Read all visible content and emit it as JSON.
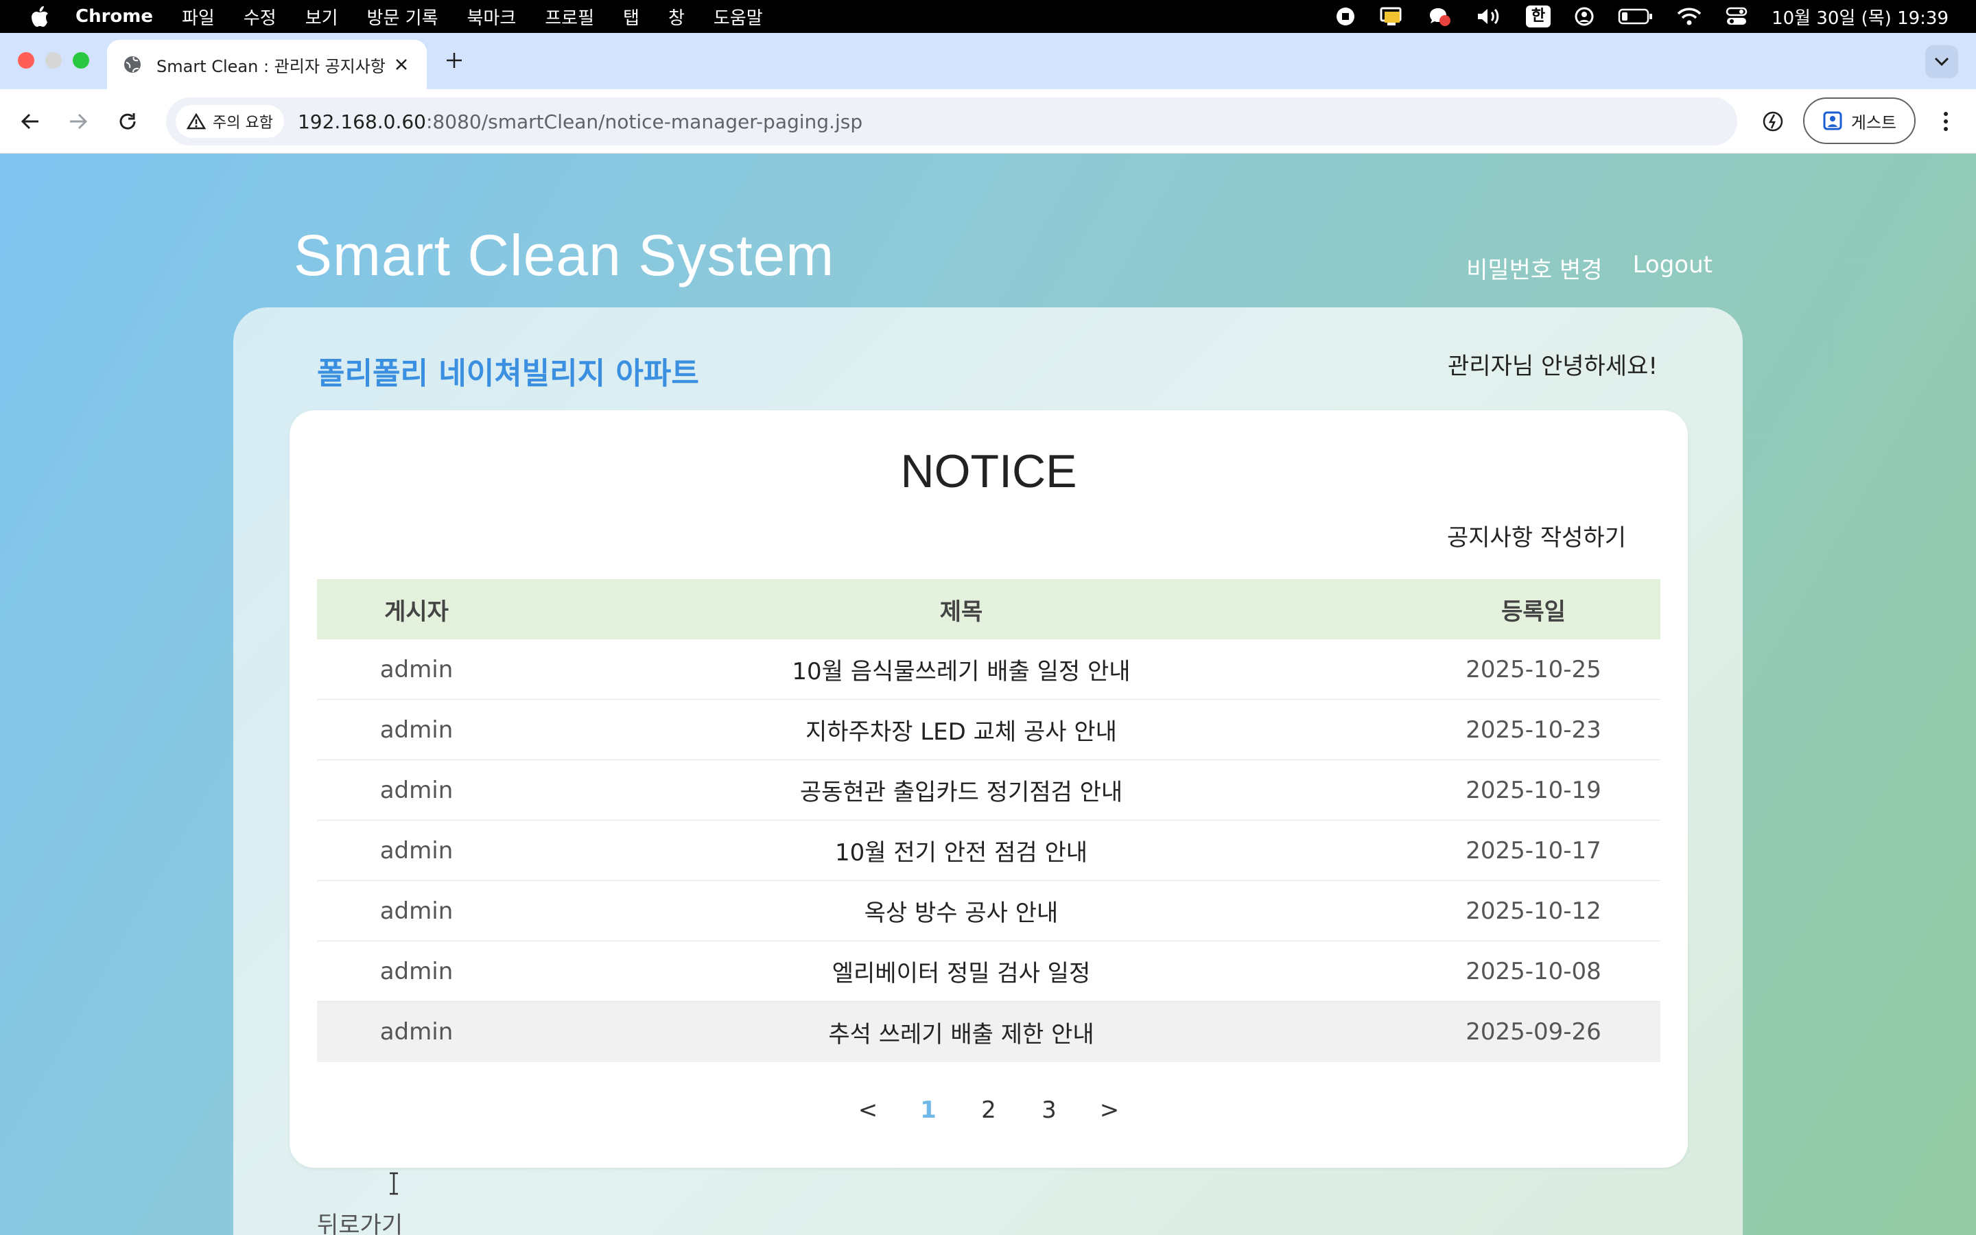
{
  "menubar": {
    "app_name": "Chrome",
    "items": [
      "파일",
      "수정",
      "보기",
      "방문 기록",
      "북마크",
      "프로필",
      "탭",
      "창",
      "도움말"
    ],
    "ime_label": "한",
    "clock": "10월 30일 (목) 19:39"
  },
  "browser": {
    "tab_title": "Smart Clean : 관리자 공지사항",
    "security_chip": "주의 요함",
    "url_host": "192.168.0.60",
    "url_rest": ":8080/smartClean/notice-manager-paging.jsp",
    "profile_label": "게스트"
  },
  "header": {
    "brand": "Smart Clean System",
    "nav": {
      "change_password": "비밀번호 변경",
      "logout": "Logout"
    }
  },
  "panel": {
    "apartment_name": "폴리폴리 네이쳐빌리지 아파트",
    "greeting": "관리자님 안녕하세요!"
  },
  "notice": {
    "title": "NOTICE",
    "write_link": "공지사항 작성하기",
    "columns": {
      "author": "게시자",
      "title": "제목",
      "date": "등록일"
    },
    "rows": [
      {
        "author": "admin",
        "title": "10월 음식물쓰레기 배출 일정 안내",
        "date": "2025-10-25"
      },
      {
        "author": "admin",
        "title": "지하주차장 LED 교체 공사 안내",
        "date": "2025-10-23"
      },
      {
        "author": "admin",
        "title": "공동현관 출입카드 정기점검 안내",
        "date": "2025-10-19"
      },
      {
        "author": "admin",
        "title": "10월 전기 안전 점검 안내",
        "date": "2025-10-17"
      },
      {
        "author": "admin",
        "title": "옥상 방수 공사 안내",
        "date": "2025-10-12"
      },
      {
        "author": "admin",
        "title": "엘리베이터 정밀 검사 일정",
        "date": "2025-10-08"
      },
      {
        "author": "admin",
        "title": "추석 쓰레기 배출 제한 안내",
        "date": "2025-09-26"
      }
    ],
    "pagination": {
      "prev": "<",
      "pages": [
        "1",
        "2",
        "3"
      ],
      "current": "1",
      "next": ">"
    }
  },
  "footer": {
    "back_label": "뒤로가기"
  },
  "colors": {
    "apartment_name": "#3a8fe0",
    "table_header_bg": "#e4f1dc",
    "active_page": "#6fb9e8"
  }
}
